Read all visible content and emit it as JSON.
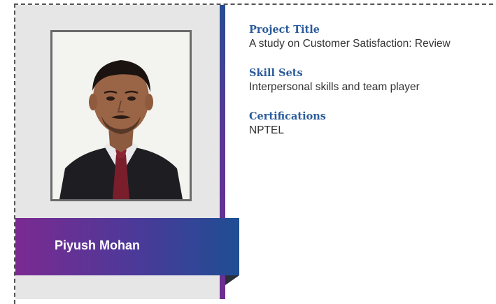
{
  "profile": {
    "name": "Piyush Mohan",
    "photo_icon": "person-portrait"
  },
  "details": [
    {
      "label": "Project Title",
      "value": "A study on Customer Satisfaction: Review"
    },
    {
      "label": "Skill Sets",
      "value": "Interpersonal skills and team player"
    },
    {
      "label": "Certifications",
      "value": "NPTEL"
    }
  ],
  "colors": {
    "panel_bg": "#e6e6e7",
    "label_blue": "#2a5b9b",
    "band_start": "#7b2a91",
    "band_end": "#1f4e93"
  }
}
